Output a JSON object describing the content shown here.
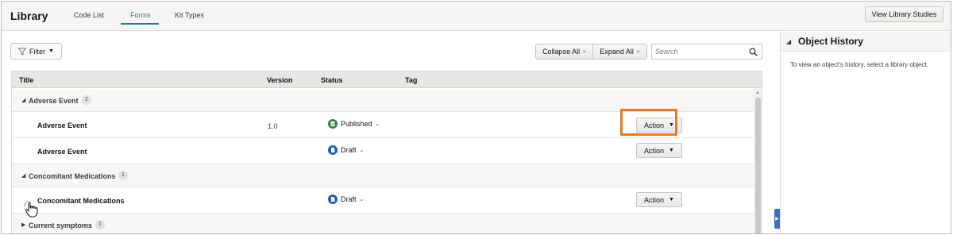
{
  "header": {
    "app_title": "Library",
    "tabs": [
      {
        "label": "Code List"
      },
      {
        "label": "Forms"
      },
      {
        "label": "Kit Types"
      }
    ],
    "view_studies_label": "View Library Studies"
  },
  "toolbar": {
    "filter_label": "Filter",
    "collapse_label": "Collapse All",
    "expand_label": "Expand All",
    "search_placeholder": "Search"
  },
  "table": {
    "columns": [
      "Title",
      "Version",
      "Status",
      "Tag"
    ],
    "groups": [
      {
        "label": "Adverse Event",
        "count": "2",
        "rows": [
          {
            "title": "Adverse Event",
            "version": "1.0",
            "status": "Published",
            "action": "Action"
          },
          {
            "title": "Adverse Event",
            "version": "",
            "status": "Draft",
            "action": "Action"
          }
        ]
      },
      {
        "label": "Concomitant Medications",
        "count": "1",
        "rows": [
          {
            "title": "Concomitant Medications",
            "version": "",
            "status": "Draft",
            "action": "Action"
          }
        ]
      },
      {
        "label": "Current symptoms",
        "count": "1",
        "rows": []
      }
    ]
  },
  "panel": {
    "title": "Object History",
    "message": "To view an object's history, select a library object."
  },
  "colors": {
    "accent": "#227e9e",
    "published": "#3a7d44",
    "draft": "#1f5fb7",
    "highlight": "#e47d26"
  }
}
